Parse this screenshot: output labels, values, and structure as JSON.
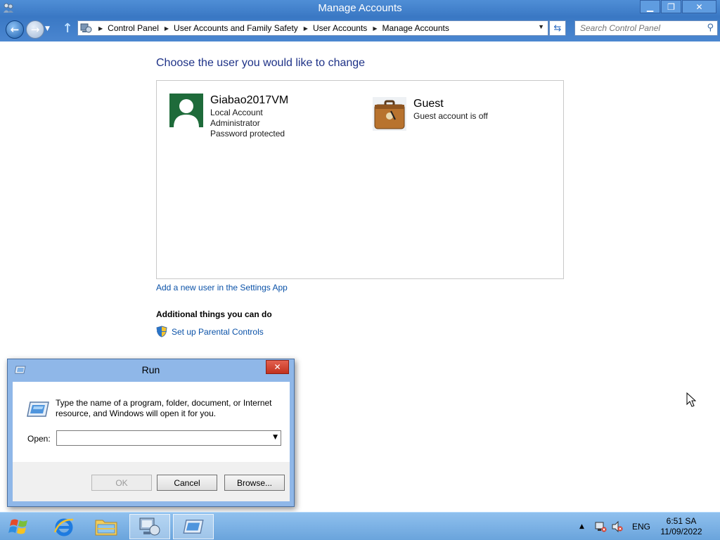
{
  "window": {
    "title": "Manage Accounts",
    "minimize_glyph": "▁",
    "maximize_glyph": "❐",
    "close_glyph": "✕"
  },
  "nav": {
    "breadcrumbs": [
      "Control Panel",
      "User Accounts and Family Safety",
      "User Accounts",
      "Manage Accounts"
    ],
    "search_placeholder": "Search Control Panel"
  },
  "main": {
    "heading": "Choose the user you would like to change",
    "accounts": [
      {
        "name": "Giabao2017VM",
        "details": [
          "Local Account",
          "Administrator",
          "Password protected"
        ],
        "icon": "user-silhouette-icon"
      },
      {
        "name": "Guest",
        "details": [
          "Guest account is off"
        ],
        "icon": "guest-suitcase-icon"
      }
    ],
    "add_user_link": "Add a new user in the Settings App",
    "additional_heading": "Additional things you can do",
    "parental_controls_link": "Set up Parental Controls"
  },
  "run_dialog": {
    "title": "Run",
    "description": "Type the name of a program, folder, document, or Internet resource, and Windows will open it for you.",
    "open_label": "Open:",
    "open_value": "",
    "buttons": {
      "ok": "OK",
      "cancel": "Cancel",
      "browse": "Browse..."
    }
  },
  "taskbar": {
    "items": [
      "start-button",
      "internet-explorer",
      "file-explorer",
      "control-panel",
      "run"
    ],
    "language": "ENG",
    "time": "6:51 SA",
    "date": "11/09/2022"
  },
  "colors": {
    "titlebar": "#3a78c4",
    "heading": "#1e3287",
    "link": "#0b52a8",
    "account_green": "#1e6b3a",
    "taskbar": "#6aa4dc"
  }
}
